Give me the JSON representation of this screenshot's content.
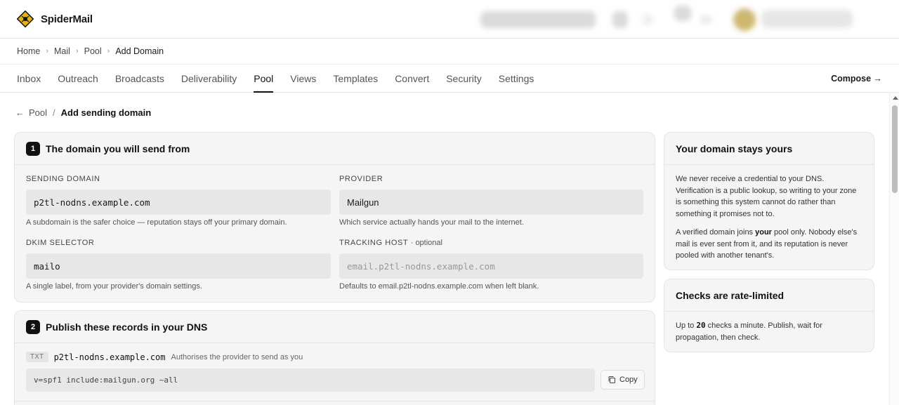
{
  "app": {
    "name": "SpiderMail"
  },
  "breadcrumb": {
    "items": [
      "Home",
      "Mail",
      "Pool"
    ],
    "current": "Add Domain"
  },
  "tabs": [
    {
      "label": "Inbox"
    },
    {
      "label": "Outreach"
    },
    {
      "label": "Broadcasts"
    },
    {
      "label": "Deliverability"
    },
    {
      "label": "Pool",
      "active": true
    },
    {
      "label": "Views"
    },
    {
      "label": "Templates"
    },
    {
      "label": "Convert"
    },
    {
      "label": "Security"
    },
    {
      "label": "Settings"
    }
  ],
  "compose": {
    "label": "Compose →"
  },
  "page": {
    "back_label": "Pool",
    "separator": "/",
    "title": "Add sending domain"
  },
  "section1": {
    "step": "1",
    "title": "The domain you will send from",
    "sending_domain": {
      "label": "SENDING DOMAIN",
      "value": "p2tl-nodns.example.com",
      "hint": "A subdomain is the safer choice — reputation stays off your primary domain."
    },
    "provider": {
      "label": "PROVIDER",
      "value": "Mailgun",
      "hint": "Which service actually hands your mail to the internet."
    },
    "dkim": {
      "label": "DKIM SELECTOR",
      "value": "mailo",
      "hint": "A single label, from your provider's domain settings."
    },
    "tracking": {
      "label": "TRACKING HOST",
      "optional": "· optional",
      "placeholder": "email.p2tl-nodns.example.com",
      "hint": "Defaults to email.p2tl-nodns.example.com when left blank."
    }
  },
  "section2": {
    "step": "2",
    "title": "Publish these records in your DNS",
    "records": [
      {
        "type": "TXT",
        "host": "p2tl-nodns.example.com",
        "description": "Authorises the provider to send as you",
        "value": "v=spf1 include:mailgun.org ~all",
        "copy_label": "Copy"
      }
    ]
  },
  "sidebar": {
    "domain_card": {
      "title": "Your domain stays yours",
      "p1": "We never receive a credential to your DNS. Verification is a public lookup, so writing to your zone is something this system cannot do rather than something it promises not to.",
      "p2_pre": "A verified domain joins ",
      "p2_bold": "your",
      "p2_post": " pool only. Nobody else's mail is ever sent from it, and its reputation is never pooled with another tenant's."
    },
    "rate_card": {
      "title": "Checks are rate-limited",
      "text_pre": "Up to ",
      "text_num": "20",
      "text_post": " checks a minute. Publish, wait for propagation, then check."
    }
  },
  "colors": {
    "accent": "#111111",
    "brand": "#e8b400",
    "card_bg": "#f5f5f5",
    "input_bg": "#e7e7e7"
  }
}
